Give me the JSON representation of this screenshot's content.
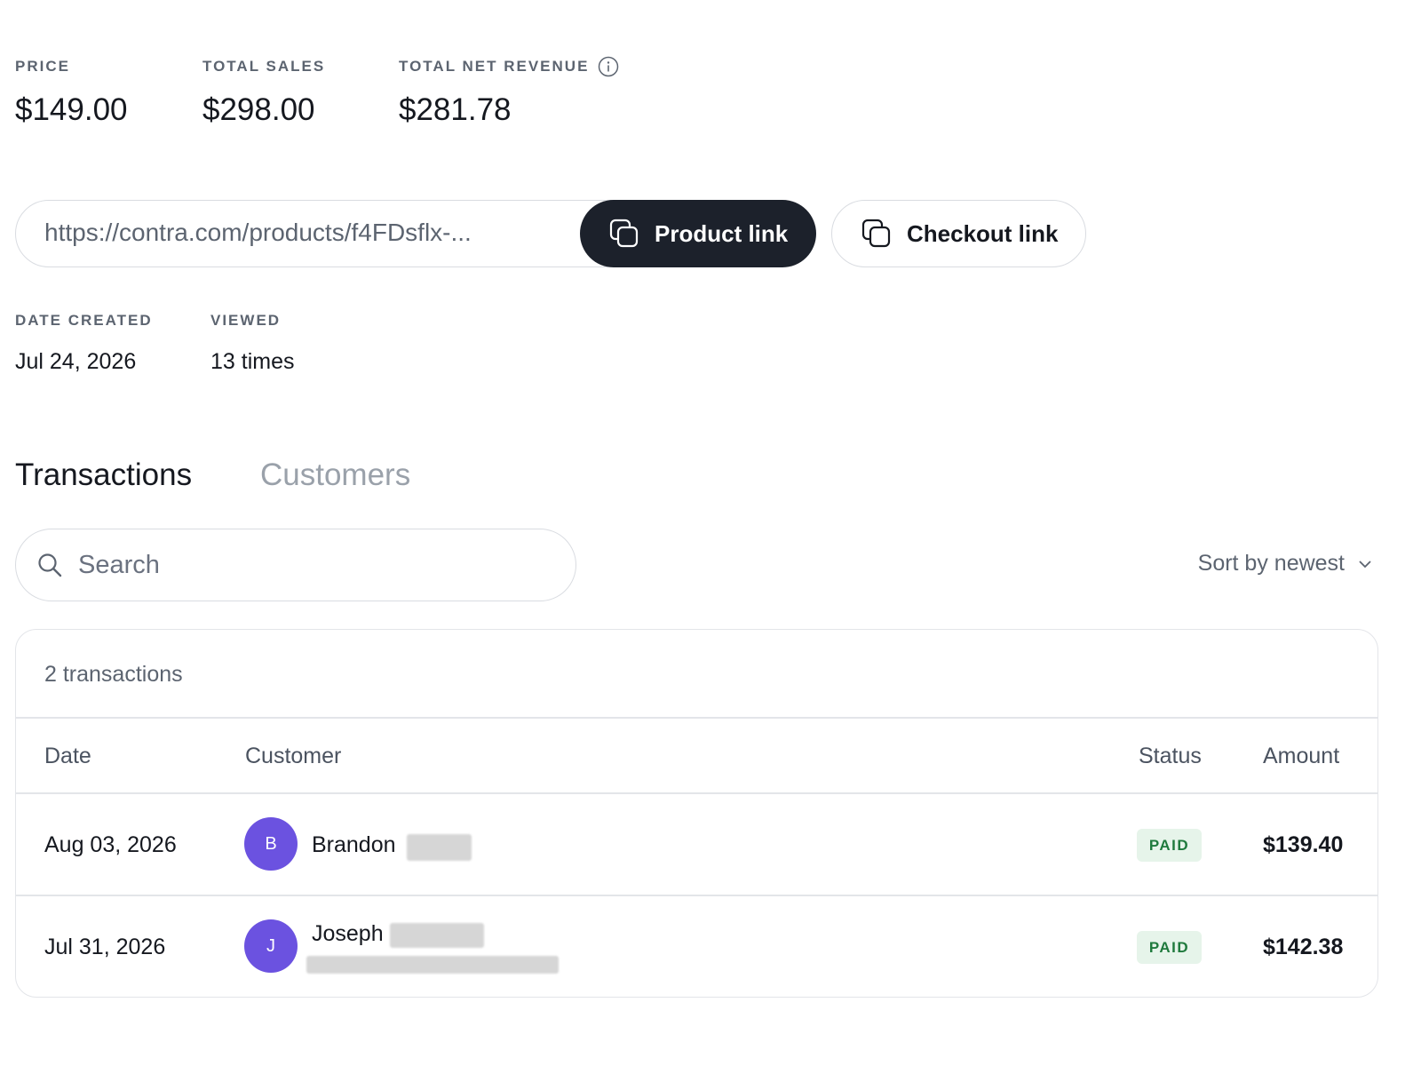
{
  "stats": {
    "price_label": "PRICE",
    "price_value": "$149.00",
    "sales_label": "TOTAL SALES",
    "sales_value": "$298.00",
    "revenue_label": "TOTAL NET REVENUE",
    "revenue_value": "$281.78"
  },
  "links": {
    "url": "https://contra.com/products/f4FDsflx-...",
    "product_label": "Product link",
    "checkout_label": "Checkout link"
  },
  "meta": {
    "date_label": "DATE CREATED",
    "date_value": "Jul 24, 2026",
    "viewed_label": "VIEWED",
    "viewed_value": "13 times"
  },
  "tabs": [
    {
      "label": "Transactions",
      "active": true
    },
    {
      "label": "Customers",
      "active": false
    }
  ],
  "search": {
    "placeholder": "Search"
  },
  "sort": {
    "label": "Sort by newest"
  },
  "table": {
    "count": "2 transactions",
    "headers": {
      "date": "Date",
      "customer": "Customer",
      "status": "Status",
      "amount": "Amount"
    },
    "rows": [
      {
        "date": "Aug 03, 2026",
        "initial": "B",
        "name": "Brandon",
        "status": "PAID",
        "amount": "$139.40"
      },
      {
        "date": "Jul 31, 2026",
        "initial": "J",
        "name": "Joseph",
        "status": "PAID",
        "amount": "$142.38"
      }
    ]
  },
  "colors": {
    "primary_button": "#1c212b",
    "avatar": "#6b52e0",
    "paid_badge_bg": "#e6f4ea",
    "paid_badge_text": "#1f7a3d"
  }
}
